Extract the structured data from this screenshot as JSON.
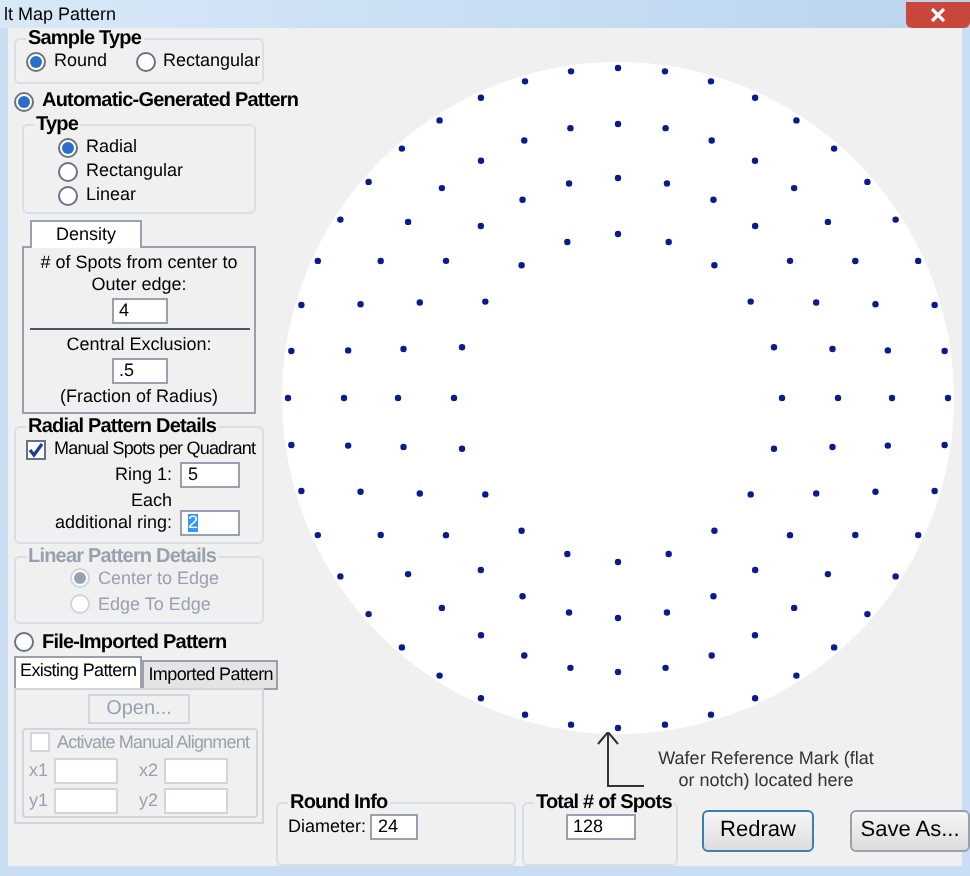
{
  "window": {
    "title": "lt Map Pattern"
  },
  "sample_type": {
    "label": "Sample Type",
    "options": [
      {
        "label": "Round",
        "selected": true
      },
      {
        "label": "Rectangular",
        "selected": false
      }
    ]
  },
  "automatic": {
    "label": "Automatic-Generated Pattern",
    "selected": true
  },
  "type_group": {
    "label": "Type",
    "options": [
      {
        "label": "Radial",
        "selected": true
      },
      {
        "label": "Rectangular",
        "selected": false
      },
      {
        "label": "Linear",
        "selected": false
      }
    ]
  },
  "density": {
    "tab": "Density",
    "spots_label": "# of Spots from center to Outer edge:",
    "spots_value": "4",
    "exclusion_label": "Central Exclusion:",
    "exclusion_value": ".5",
    "exclusion_note": "(Fraction of Radius)"
  },
  "radial_details": {
    "label": "Radial Pattern Details",
    "manual": {
      "label": "Manual Spots per Quadrant",
      "checked": true
    },
    "ring1_label": "Ring 1:",
    "ring1_value": "5",
    "additional_label": "Each additional ring:",
    "additional_value": "2"
  },
  "linear_details": {
    "label": "Linear Pattern Details",
    "disabled": true,
    "options": [
      {
        "label": "Center to Edge",
        "selected": true
      },
      {
        "label": "Edge To Edge",
        "selected": false
      }
    ]
  },
  "file_imported": {
    "label": "File-Imported Pattern",
    "selected": false,
    "disabled": true,
    "tabs": [
      {
        "label": "Existing Pattern",
        "selected": true
      },
      {
        "label": "Imported Pattern",
        "selected": false
      }
    ],
    "open_button": "Open...",
    "alignment": {
      "label": "Activate Manual Alignment",
      "checked": false
    },
    "fields": [
      {
        "label": "x1"
      },
      {
        "label": "x2"
      },
      {
        "label": "y1"
      },
      {
        "label": "y2"
      }
    ]
  },
  "wafer_note": "Wafer Reference Mark (flat or notch) located here",
  "round_info": {
    "label": "Round Info",
    "diameter_label": "Diameter:",
    "diameter_value": "24"
  },
  "total_spots": {
    "label": "Total # of Spots",
    "value": "128"
  },
  "buttons": [
    {
      "label": "Redraw",
      "kind": "default"
    },
    {
      "label": "Save As...",
      "kind": "normal"
    }
  ]
}
